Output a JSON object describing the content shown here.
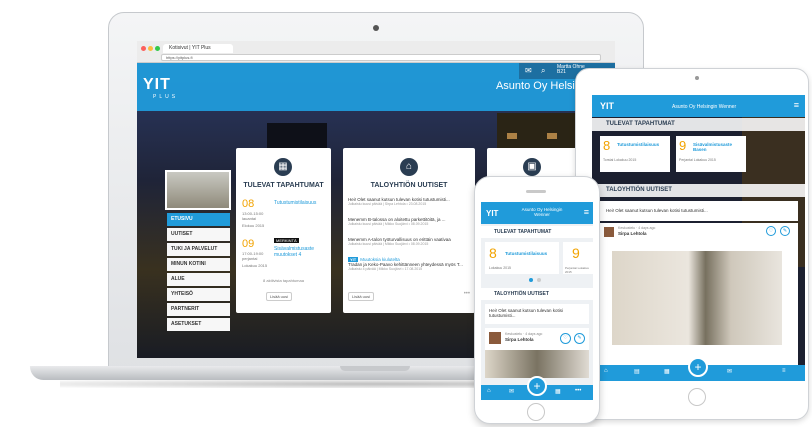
{
  "laptop": {
    "browser_tab": "Kotisivut | YIT Plus",
    "address": "https://yitplus.fi",
    "logo": "YIT",
    "logo_sub": "PLUS",
    "site_title": "Asunto Oy Helsingin We",
    "user_name": "Martta Ohne",
    "user_sub": "B21",
    "menu": [
      "ETUSIVU",
      "UUTISET",
      "TUKI JA PALVELUT",
      "MINUN KOTINI",
      "ALUE",
      "YHTEISÖ",
      "PARTNERIT",
      "ASETUKSET"
    ],
    "events": {
      "title": "TULEVAT TAPAHTUMAT",
      "items": [
        {
          "date": "08",
          "time": "13:00-15:00 lauantai",
          "month": "Elokuu 2015",
          "title": "Tutustumistilaisuus"
        },
        {
          "date": "09",
          "time": "17:00-19:00 perjantai",
          "month": "Lokakuu 2015",
          "badge": "MERKINTÄ",
          "title": "Sisävalmistusaste muutokset 4"
        }
      ],
      "footer": "8 aktiivista tapahtumaa",
      "button": "Lisää uusi"
    },
    "news": {
      "title": "TALOYHTIÖN UUTISET",
      "items": [
        {
          "text": "Hei! Olet saanut kutsun tulevan kotisi tutustumisti...",
          "meta": "Julkaistu kuusi päivää | Sirpa Lehtola • 23.08.2015"
        },
        {
          "text": "Menemm B-talossa on aloitettu parkettitöitä, ja ...",
          "meta": "Julkaistu kuusi päivää | Mikko Suojärvi • 08.09.2015"
        },
        {
          "text": "Menemm A-talon työturvallisuus on erittäin vaativaa",
          "meta": "Julkaistu kuusi päivää | Mikko Suojärvi • 08.09.2015"
        },
        {
          "tag": "YIT",
          "text": "Muutoksia kiulutelta",
          "sub": "Tradan ja Keko-Paavo kehittänneen yhteydessä myös T...",
          "meta": "Julkaistu 4 päivää | Mikko Suojärvi • 17.08.2015"
        }
      ],
      "button": "Lisää uusi"
    }
  },
  "tablet": {
    "logo": "YIT",
    "title": "Asunto Oy Helsingin Wenner",
    "events_title": "TULEVAT TAPAHTUMAT",
    "event1": {
      "num": "8",
      "label": "Tutustumistilaisuus",
      "sub": "Torstai Lokakuu 2015"
    },
    "event2": {
      "num": "9",
      "label": "Sisävalmistusaste Basen",
      "sub": "Perjantai Lokakuu 2015"
    },
    "news_title": "TALOYHTIÖN UUTISET",
    "news_text": "Hei! Olet saanut kutsun tulevan kotisi tutustumisti...",
    "author": "Sirpa Lehtola",
    "author_meta": "Keskustelu · 4 days ago",
    "caption": "Menemm B-talossa on aloitettu parkettitöitä, ja ...",
    "nav": [
      "Etusivu",
      "Uutiset",
      "Tapahtumat",
      "Keskustelu",
      "Viestit",
      "YIT Plus"
    ]
  },
  "phone": {
    "logo": "YIT",
    "title": "Asunto Oy Helsingin Wenner",
    "events_title": "TULEVAT TAPAHTUMAT",
    "event1": {
      "num": "8",
      "label": "Tutustumistilaisuus",
      "sub": "Lokakuu 2015"
    },
    "event2": {
      "num": "9",
      "label": "",
      "sub": "Perjantai Lokakuu 2015"
    },
    "news_title": "TALOYHTIÖN UUTISET",
    "news_text": "Hei! Olet saanut kutsun tulevan kotisi tutustumisti...",
    "author": "Sirpa Lehtola",
    "author_meta": "Keskustelu · 4 days ago",
    "nav": [
      "Etusivu",
      "Keskustelu",
      "Tapahtumat",
      "Lisää"
    ]
  },
  "colors": {
    "brand_blue": "#209bda",
    "accent_orange": "#f2a300",
    "dark_navy": "#2a3d52"
  }
}
